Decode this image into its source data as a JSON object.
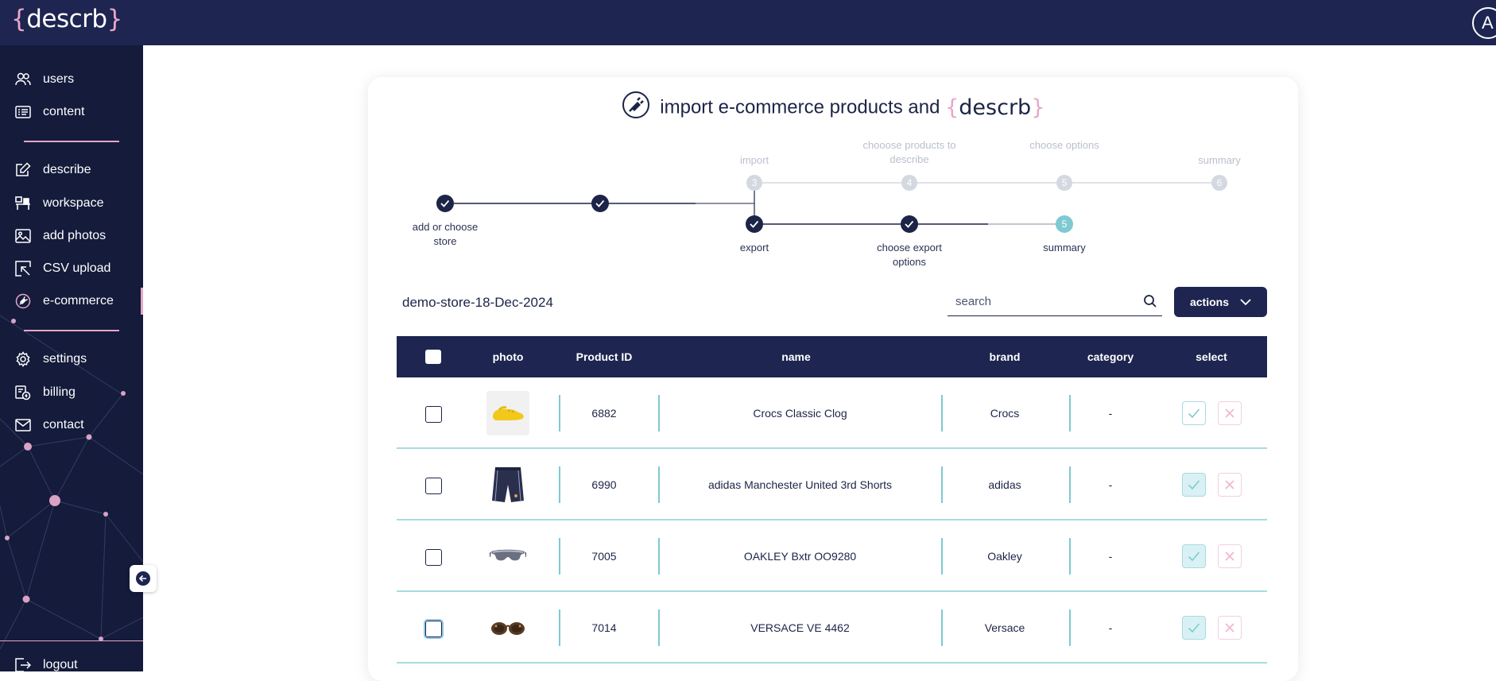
{
  "app": {
    "logo_open": "{",
    "logo_text": "descrb",
    "logo_close": "}",
    "avatar_initial": "A"
  },
  "sidebar": {
    "items_top": [
      {
        "label": "users",
        "icon": "users-icon"
      },
      {
        "label": "content",
        "icon": "content-list-icon"
      }
    ],
    "items_mid": [
      {
        "label": "describe",
        "icon": "edit-icon"
      },
      {
        "label": "workspace",
        "icon": "workspace-icon"
      },
      {
        "label": "add photos",
        "icon": "image-icon"
      },
      {
        "label": "CSV upload",
        "icon": "csv-upload-icon"
      },
      {
        "label": "e-commerce",
        "icon": "plug-icon",
        "active": true
      }
    ],
    "items_bottom": [
      {
        "label": "settings",
        "icon": "gear-icon"
      },
      {
        "label": "billing",
        "icon": "billing-icon"
      },
      {
        "label": "contact",
        "icon": "mail-icon"
      }
    ],
    "logout": "logout",
    "accent": "#e7a6c8"
  },
  "page": {
    "title_text": "import e-commerce products and",
    "title_brand_open": "{",
    "title_brand": "descrb",
    "title_brand_close": "}"
  },
  "stepper": {
    "top_steps": [
      {
        "label": "import",
        "number": "3",
        "state": "upcoming"
      },
      {
        "label": "chooose products to describe",
        "number": "4",
        "state": "upcoming"
      },
      {
        "label": "choose options",
        "number": "5",
        "state": "upcoming"
      },
      {
        "label": "summary",
        "number": "6",
        "state": "upcoming"
      }
    ],
    "shared_steps": [
      {
        "label": "add or choose store",
        "state": "done"
      },
      {
        "label": "",
        "state": "done"
      }
    ],
    "bottom_steps": [
      {
        "label": "export",
        "state": "done"
      },
      {
        "label": "choose export options",
        "state": "done"
      },
      {
        "label": "summary",
        "number": "5",
        "state": "current"
      }
    ]
  },
  "toolbar": {
    "store_name": "demo-store-18-Dec-2024",
    "search_placeholder": "search",
    "actions_label": "actions"
  },
  "table": {
    "headers": {
      "photo": "photo",
      "product_id": "Product ID",
      "name": "name",
      "brand": "brand",
      "category": "category",
      "select": "select"
    },
    "rows": [
      {
        "id": "6882",
        "name": "Crocs Classic Clog",
        "brand": "Crocs",
        "category": "-",
        "photo": "yellow-clog",
        "selected": false
      },
      {
        "id": "6990",
        "name": "adidas Manchester United 3rd Shorts",
        "brand": "adidas",
        "category": "-",
        "photo": "navy-shorts",
        "selected": true
      },
      {
        "id": "7005",
        "name": "OAKLEY Bxtr OO9280",
        "brand": "Oakley",
        "category": "-",
        "photo": "sport-sunglasses",
        "selected": true
      },
      {
        "id": "7014",
        "name": "VERSACE VE 4462",
        "brand": "Versace",
        "category": "-",
        "photo": "tortoise-sunglasses",
        "selected": true
      }
    ]
  },
  "colors": {
    "navy": "#1d2550",
    "teal": "#7fc9d2",
    "pink": "#e7a6c8"
  }
}
